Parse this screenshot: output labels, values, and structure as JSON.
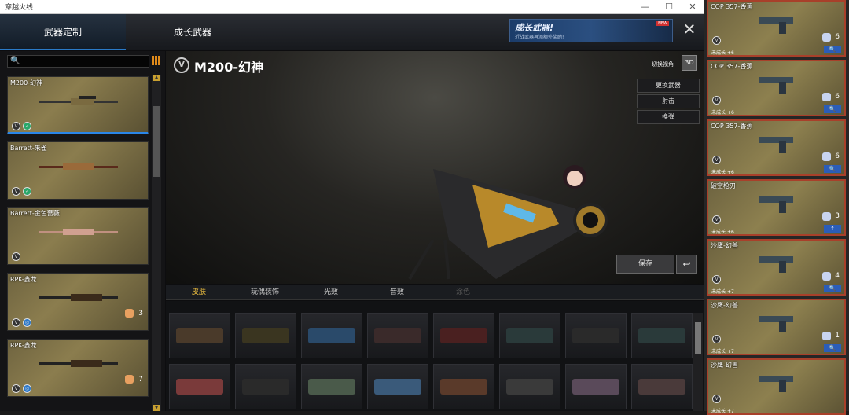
{
  "window": {
    "title": "穿越火线"
  },
  "topnav": {
    "tabs": [
      {
        "label": "武器定制"
      },
      {
        "label": "成长武器"
      }
    ],
    "banner": {
      "title": "成长武器!",
      "subtitle": "近战武器再添额外奖励!",
      "badge": "NEW"
    },
    "close_icon": "close-icon"
  },
  "left": {
    "items": [
      {
        "name": "M200-幻神",
        "count": ""
      },
      {
        "name": "Barrett-朱雀",
        "count": ""
      },
      {
        "name": "Barrett-金色蔷薇",
        "count": ""
      },
      {
        "name": "RPK-鑫龙",
        "count": "3"
      },
      {
        "name": "RPK-鑫龙",
        "count": "7"
      }
    ]
  },
  "viewer": {
    "weapon_name": "M200-幻神",
    "view_label": "切换视角",
    "view_btn": "3D",
    "buttons": [
      {
        "label": "更换武器"
      },
      {
        "label": "射击"
      },
      {
        "label": "换弹"
      }
    ],
    "save_label": "保存",
    "back_label": "↩"
  },
  "subtabs": [
    {
      "label": "皮肤"
    },
    {
      "label": "玩偶装饰"
    },
    {
      "label": "光效"
    },
    {
      "label": "音效"
    },
    {
      "label": "涂色"
    }
  ],
  "skins": {
    "row1": [
      "#4a3a2a",
      "#3a3520",
      "#2a4a6a",
      "#3a2a2a",
      "#4a2020",
      "#2a3a3a",
      "#2a2a2a",
      "#2a3a3a"
    ],
    "row2": [
      "#7a3a3a",
      "#2a2a2a",
      "#4a5a4a",
      "#3a5a7a",
      "#5a3a2a",
      "#3a3a3a",
      "#5a4a5a",
      "#4a3a3a"
    ]
  },
  "right": {
    "items": [
      {
        "name": "COP 357-香蕉",
        "level": "+6",
        "count": "6",
        "action": "🔍",
        "status": "未成长"
      },
      {
        "name": "COP 357-香蕉",
        "level": "+6",
        "count": "6",
        "action": "🔍",
        "status": "未成长"
      },
      {
        "name": "COP 357-香蕉",
        "level": "+6",
        "count": "6",
        "action": "🔍",
        "status": "未成长"
      },
      {
        "name": "破空枪刃",
        "level": "+6",
        "count": "3",
        "action": "↑",
        "status": "未成长"
      },
      {
        "name": "沙鹰-幻兽",
        "level": "+7",
        "count": "4",
        "action": "🔍",
        "status": "未成长"
      },
      {
        "name": "沙鹰-幻兽",
        "level": "+7",
        "count": "1",
        "action": "🔍",
        "status": "未成长"
      },
      {
        "name": "沙鹰-幻兽",
        "level": "+7",
        "count": "",
        "action": "",
        "status": "未成长"
      }
    ]
  }
}
